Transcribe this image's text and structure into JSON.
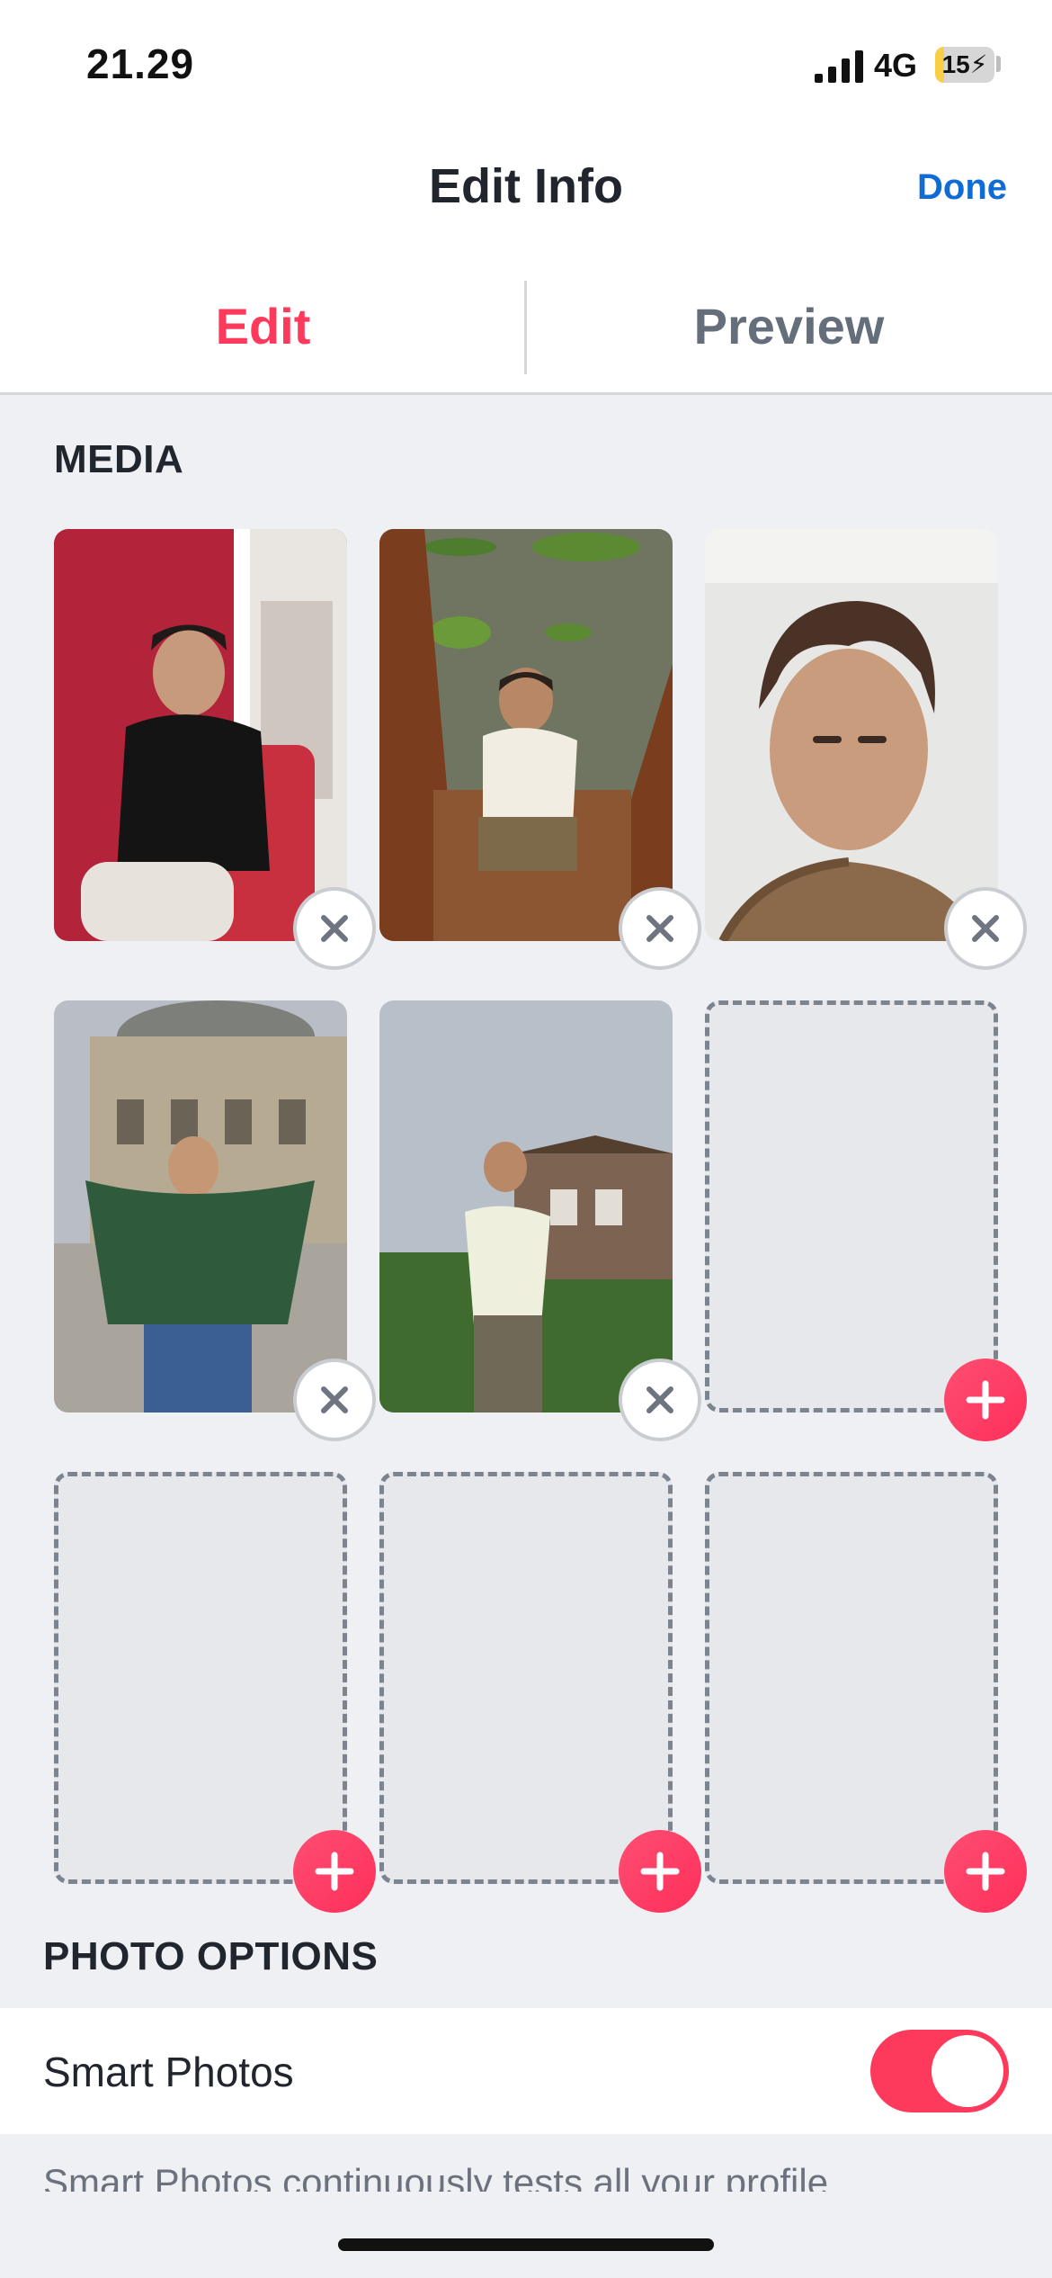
{
  "status_bar": {
    "time": "21.29",
    "network": "4G",
    "battery": "15",
    "battery_level": 0.15,
    "battery_color": "#f7ce46"
  },
  "nav": {
    "title": "Edit Info",
    "done": "Done"
  },
  "tabs": {
    "edit": "Edit",
    "preview": "Preview",
    "active": "Edit"
  },
  "media": {
    "title": "MEDIA",
    "slots": [
      {
        "state": "photo",
        "description": "man in black polo on red chair"
      },
      {
        "state": "photo",
        "description": "man sitting on boat deck"
      },
      {
        "state": "photo",
        "description": "portrait close-up"
      },
      {
        "state": "photo",
        "description": "man in green sweater before domed building"
      },
      {
        "state": "photo",
        "description": "man in shirt by houseboat"
      },
      {
        "state": "empty"
      },
      {
        "state": "empty"
      },
      {
        "state": "empty"
      },
      {
        "state": "empty"
      }
    ]
  },
  "photo_options": {
    "title": "PHOTO OPTIONS",
    "smart_photos_label": "Smart Photos",
    "smart_photos_enabled": true,
    "description": "Smart Photos continuously tests all your profile"
  },
  "colors": {
    "accent": "#fd3a5c",
    "link": "#106bd5"
  }
}
